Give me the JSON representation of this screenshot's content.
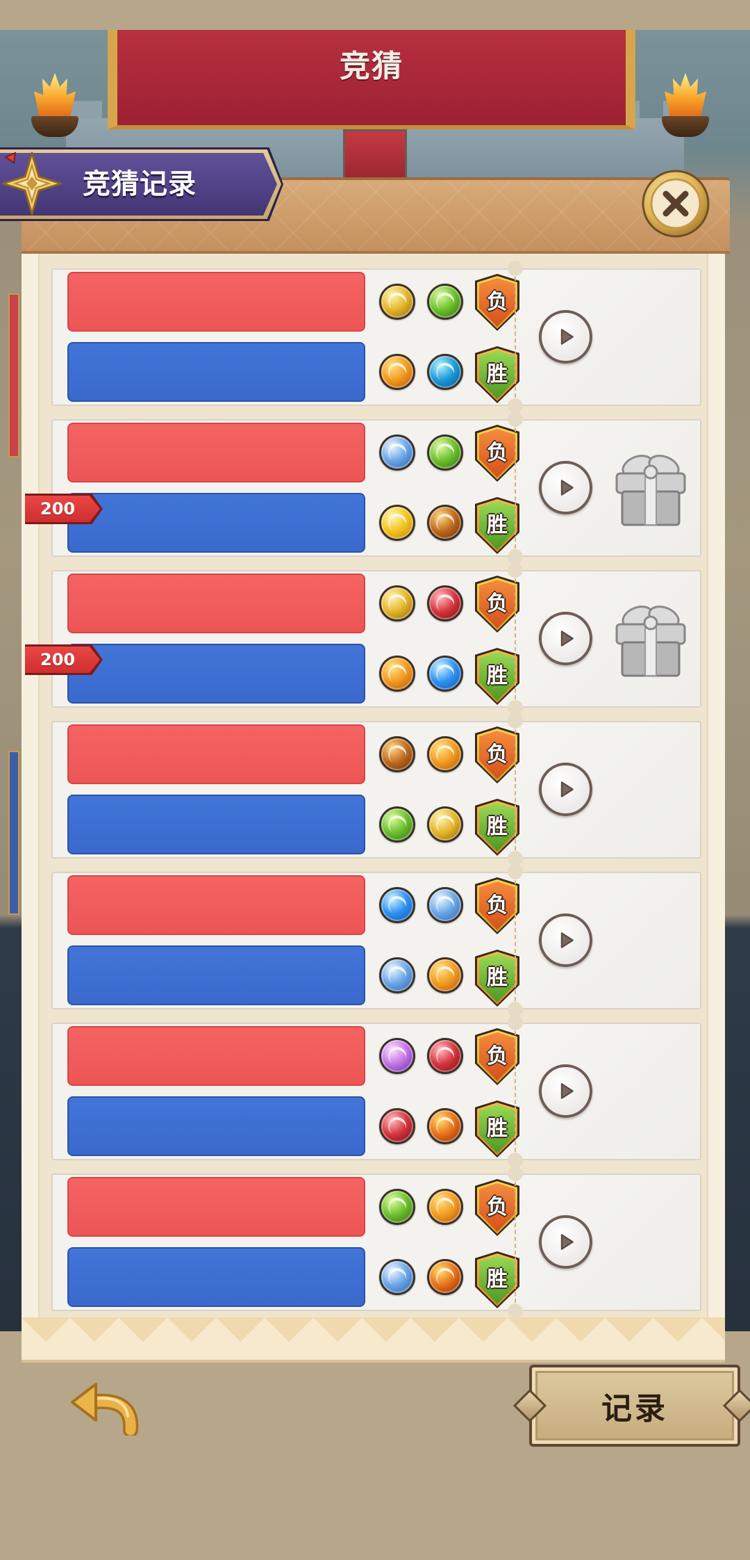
{
  "header": {
    "title": "竞猜"
  },
  "tab": {
    "label": "竞猜记录",
    "emblem_icon": "star-emblem-icon"
  },
  "close_icon": "close-icon",
  "records": [
    {
      "red_team": {
        "elements": [
          "gold-element-icon",
          "green-element-icon"
        ],
        "result": "负"
      },
      "blue_team": {
        "elements": [
          "orange-element-icon",
          "teal-element-icon"
        ],
        "result": "胜"
      },
      "play_icon": "play-icon"
    },
    {
      "red_team": {
        "elements": [
          "ice-element-icon",
          "green-element-icon"
        ],
        "result": "负"
      },
      "blue_team": {
        "elements": [
          "yellow-element-icon",
          "brown-element-icon"
        ],
        "result": "胜",
        "bet": "200"
      },
      "play_icon": "play-icon",
      "reward_icon": "gift-box-icon"
    },
    {
      "red_team": {
        "elements": [
          "gold-element-icon",
          "red-element-icon"
        ],
        "result": "负"
      },
      "blue_team": {
        "elements": [
          "orange-element-icon",
          "blue-element-icon"
        ],
        "result": "胜",
        "bet": "200"
      },
      "play_icon": "play-icon",
      "reward_icon": "gift-box-icon"
    },
    {
      "red_team": {
        "elements": [
          "brown-element-icon",
          "orange-element-icon"
        ],
        "result": "负"
      },
      "blue_team": {
        "elements": [
          "green-element-icon",
          "gold-element-icon"
        ],
        "result": "胜"
      },
      "play_icon": "play-icon"
    },
    {
      "red_team": {
        "elements": [
          "blue-element-icon",
          "ice-element-icon"
        ],
        "result": "负"
      },
      "blue_team": {
        "elements": [
          "ice-element-icon",
          "orange-element-icon"
        ],
        "result": "胜"
      },
      "play_icon": "play-icon"
    },
    {
      "red_team": {
        "elements": [
          "purple-element-icon",
          "red-element-icon"
        ],
        "result": "负"
      },
      "blue_team": {
        "elements": [
          "red-element-icon",
          "fire-element-icon"
        ],
        "result": "胜"
      },
      "play_icon": "play-icon"
    },
    {
      "red_team": {
        "elements": [
          "green-element-icon",
          "orange-element-icon"
        ],
        "result": "负"
      },
      "blue_team": {
        "elements": [
          "ice-element-icon",
          "fire-element-icon"
        ],
        "result": "胜"
      },
      "play_icon": "play-icon"
    }
  ],
  "footer": {
    "back_icon": "back-arrow-icon",
    "record_button_label": "记录"
  },
  "icon_palette": {
    "gold-element-icon": {
      "light": "#fff6b8",
      "main": "#e4b52a",
      "dark": "#8d6208"
    },
    "green-element-icon": {
      "light": "#e2fba8",
      "main": "#6cc02c",
      "dark": "#2b6a10"
    },
    "orange-element-icon": {
      "light": "#ffe38a",
      "main": "#f39a1f",
      "dark": "#a8520a"
    },
    "teal-element-icon": {
      "light": "#b8f2ff",
      "main": "#1c9ad8",
      "dark": "#0c4a86"
    },
    "ice-element-icon": {
      "light": "#f0f8ff",
      "main": "#6aa6e6",
      "dark": "#2a5ca8"
    },
    "yellow-element-icon": {
      "light": "#fff8c0",
      "main": "#f4c41c",
      "dark": "#b67e06"
    },
    "brown-element-icon": {
      "light": "#ffd98a",
      "main": "#c06a1c",
      "dark": "#5e2a06"
    },
    "red-element-icon": {
      "light": "#ffc0c4",
      "main": "#d7343d",
      "dark": "#6e0c14"
    },
    "blue-element-icon": {
      "light": "#d2f4ff",
      "main": "#2e91f2",
      "dark": "#0d52ac"
    },
    "purple-element-icon": {
      "light": "#ffe0ff",
      "main": "#c274e6",
      "dark": "#6226a0"
    },
    "fire-element-icon": {
      "light": "#ffe070",
      "main": "#e8701a",
      "dark": "#862c04"
    }
  },
  "colors": {
    "red_team_bar": "#f25c5c",
    "blue_team_bar": "#3e6fd3",
    "loss_badge": "#e8702a",
    "win_badge": "#6cba3a",
    "bet_tag": "#e03c3c",
    "panel": "#efe5cf",
    "tab": "#514282",
    "banner": "#b22a3e"
  }
}
